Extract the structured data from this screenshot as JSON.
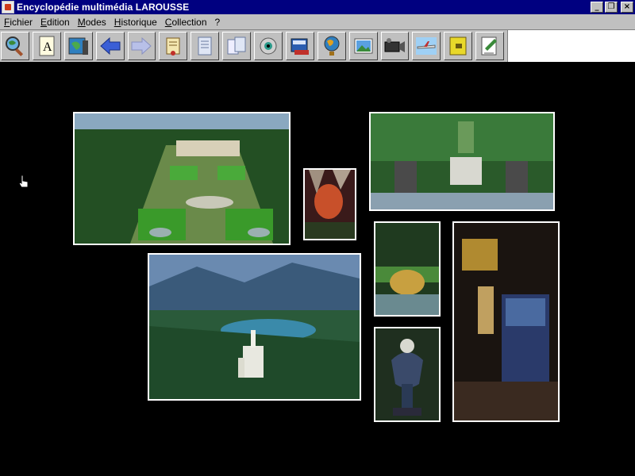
{
  "window": {
    "title": "Encyclopédie multimédia LAROUSSE",
    "app_icon": "larousse-app-icon",
    "buttons": {
      "minimize": "_",
      "restore": "❐",
      "close": "×"
    }
  },
  "menubar": {
    "items": [
      "Fichier",
      "Edition",
      "Modes",
      "Historique",
      "Collection",
      "?"
    ]
  },
  "toolbar": {
    "icons": [
      "magnifier-globe-icon",
      "dictionary-page-icon",
      "map-book-icon",
      "back-arrow-icon",
      "forward-arrow-icon",
      "scroll-icon",
      "document-icon",
      "pages-icon",
      "eye-icon",
      "book-stack-icon",
      "globe-icon",
      "picture-icon",
      "video-camera-icon",
      "airplane-icon",
      "binder-icon",
      "notes-icon"
    ]
  },
  "gallery": {
    "photos": [
      "palace-garden-aerial-photo",
      "grotto-cave-photo",
      "linderhof-garden-photo",
      "neuschwanstein-castle-photo",
      "fountain-statue-photo",
      "ornate-urn-photo",
      "bedroom-interior-photo"
    ]
  },
  "colors": {
    "titlebar": "#000080",
    "chrome": "#c0c0c0",
    "background": "#000000",
    "frame": "#ffffff"
  }
}
